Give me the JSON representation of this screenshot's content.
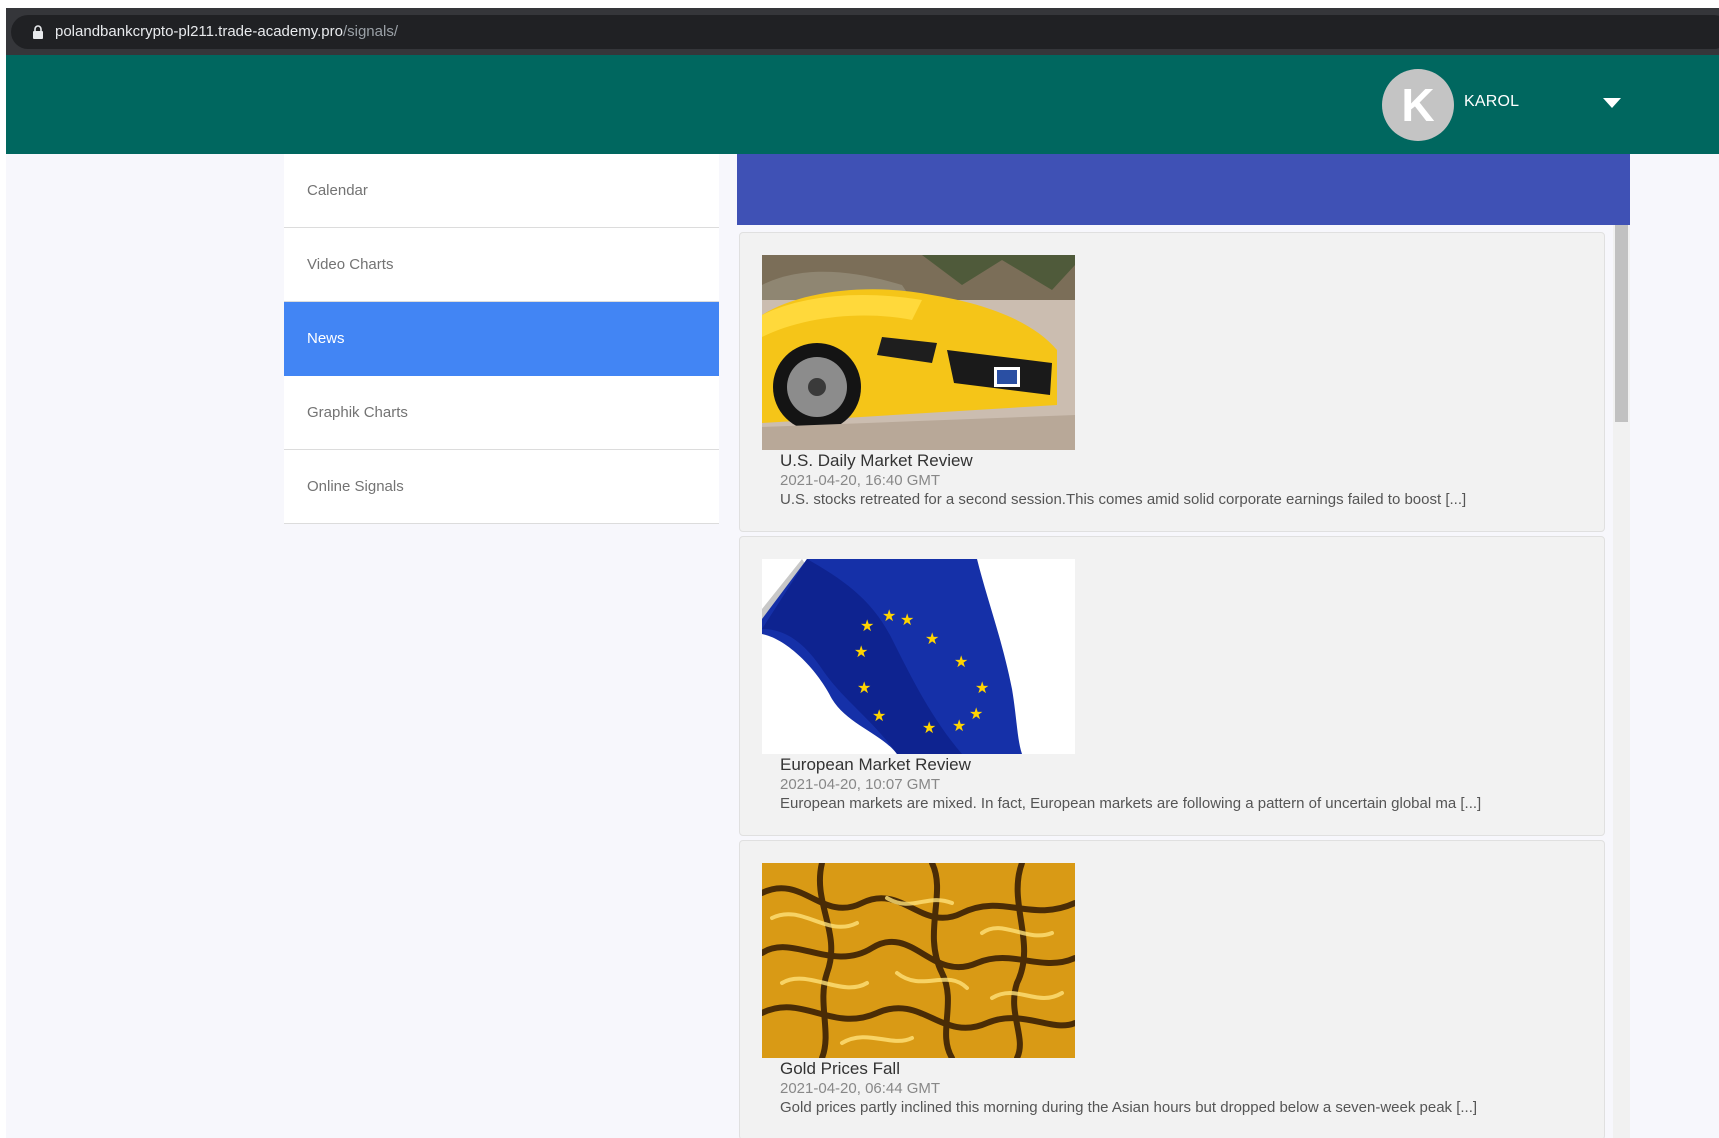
{
  "browser": {
    "url_host": "polandbankcrypto-pl211.trade-academy.pro",
    "url_path": "/signals/"
  },
  "header": {
    "avatar_initial": "K",
    "username": "KAROL"
  },
  "sidebar": {
    "items": [
      {
        "label": "Calendar",
        "active": false
      },
      {
        "label": "Video Charts",
        "active": false
      },
      {
        "label": "News",
        "active": true
      },
      {
        "label": "Graphik Charts",
        "active": false
      },
      {
        "label": "Online Signals",
        "active": false
      }
    ]
  },
  "news": [
    {
      "title": "U.S. Daily Market Review",
      "date": "2021-04-20, 16:40 GMT",
      "excerpt": "U.S. stocks retreated for a second session.This comes amid solid corporate earnings failed to boost [...]",
      "image": "yellow-sports-car"
    },
    {
      "title": "European Market Review",
      "date": "2021-04-20, 10:07 GMT",
      "excerpt": "European markets are mixed. In fact, European markets are following a pattern of uncertain global ma [...]",
      "image": "eu-flag"
    },
    {
      "title": "Gold Prices Fall",
      "date": "2021-04-20, 06:44 GMT",
      "excerpt": "Gold prices partly inclined this morning during the Asian hours but dropped below a seven-week peak [...]",
      "image": "liquid-gold"
    }
  ],
  "colors": {
    "topbar": "#00675f",
    "active_nav": "#4285f4",
    "panel_header": "#3f51b5"
  }
}
